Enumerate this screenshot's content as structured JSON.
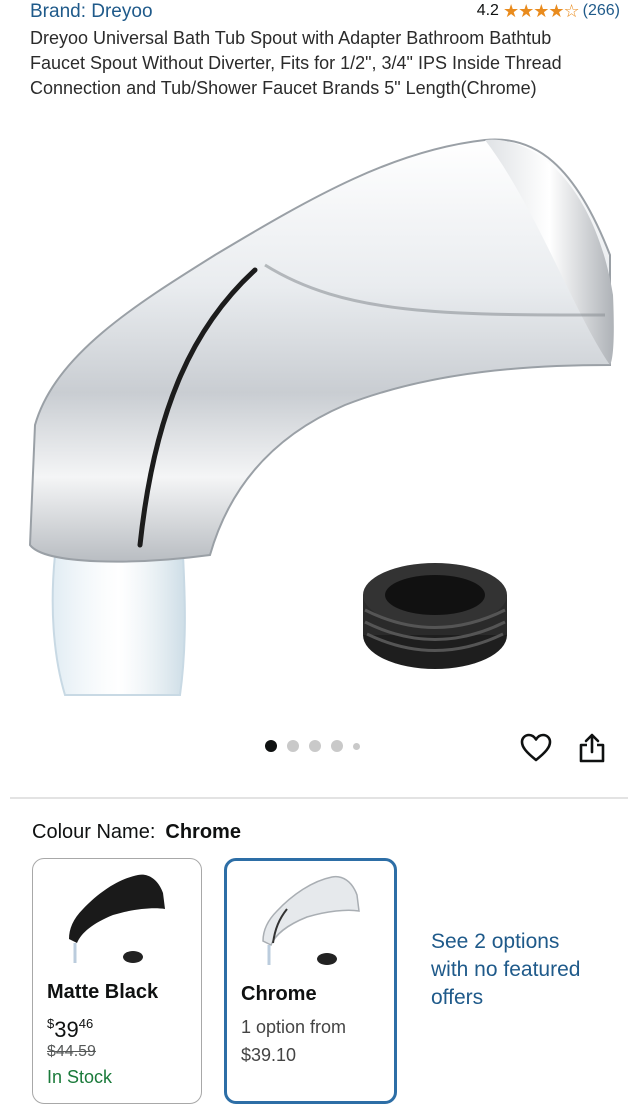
{
  "header": {
    "brand": "Brand: Dreyoo",
    "rating_value": "4.2",
    "stars": "★★★★☆",
    "rating_fraction": 0.84,
    "review_count": "(266)",
    "title": "Dreyoo Universal Bath Tub Spout with Adapter Bathroom Bathtub Faucet Spout Without Diverter, Fits for 1/2\", 3/4\" IPS Inside Thread Connection and Tub/Shower Faucet Brands 5\" Length(Chrome)"
  },
  "gallery": {
    "image_count": 5,
    "active_index": 0
  },
  "actions": {
    "wishlist_icon": "heart-icon",
    "share_icon": "share-icon"
  },
  "colour": {
    "label": "Colour Name:",
    "selected": "Chrome",
    "options": [
      {
        "name": "Matte Black",
        "price_currency": "$",
        "price_whole": "39",
        "price_fraction": "46",
        "was_price": "$44.59",
        "availability": "In Stock",
        "selected": false
      },
      {
        "name": "Chrome",
        "options_text": "1 option from",
        "options_price": "$39.10",
        "selected": true
      }
    ],
    "see_more": "See 2 options with no featured offers"
  },
  "colors": {
    "link": "#1f5a8a",
    "star": "#e98b1d",
    "stock": "#1a7a3a",
    "selected_border": "#2d6ea6"
  }
}
